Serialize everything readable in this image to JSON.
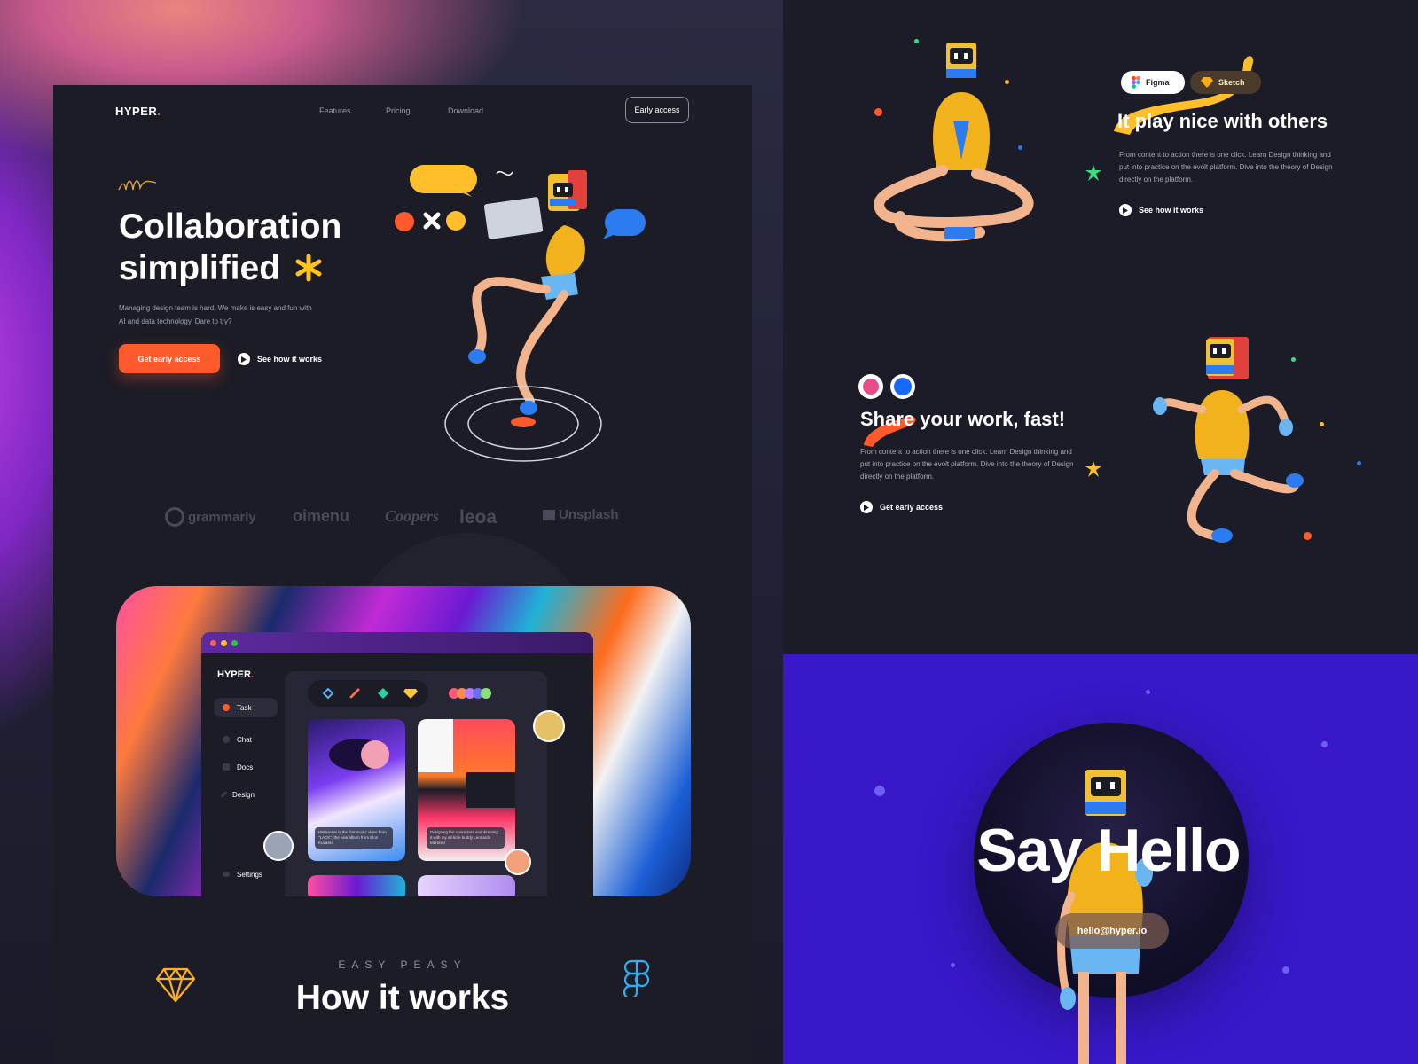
{
  "landing": {
    "logo": "HYPER",
    "logo_dot": ".",
    "nav": [
      "Features",
      "Pricing",
      "Download"
    ],
    "early_access_btn": "Early access",
    "hero": {
      "title_line1": "Collaboration",
      "title_line2": "simplified",
      "description": "Managing design team is hard. We make is easy and fun with AI and data technology. Dare to try?",
      "primary_btn": "Get early access",
      "secondary_link": "See how it works"
    },
    "brands": [
      "grammarly",
      "oimenu",
      "Coopers",
      "leoa",
      "Unsplash"
    ],
    "app": {
      "logo": "HYPER",
      "sidebar": [
        "Task",
        "Chat",
        "Docs",
        "Design",
        "Settings"
      ],
      "caption1": "Metaverse is the first music video from \"LACK\", the new album from Elon Kuvaskii",
      "caption2": "Designing the characters and directing it with my all-time buddy Leonardo Martinez"
    },
    "eyebrow": "EASY PEASY",
    "how_title": "How it works"
  },
  "section_others": {
    "chips": [
      "Figma",
      "Sketch"
    ],
    "title": "It play nice with others",
    "description": "From content to action there is one click. Learn Design thinking and put into practice on the évolt platform. Dive into the theory of Design directly on the platform.",
    "link": "See how it works"
  },
  "section_share": {
    "title": "Share your work, fast!",
    "description": "From content to action there is one click. Learn Design thinking and put into practice on the évolt platform. Dive into the theory of Design directly on the platform.",
    "link": "Get early access"
  },
  "section_hello": {
    "title": "Say Hello",
    "email": "hello@hyper.io"
  },
  "colors": {
    "accent": "#ff5a2b",
    "hello_bg": "#3818c8",
    "card_bg": "#1c1c26"
  }
}
